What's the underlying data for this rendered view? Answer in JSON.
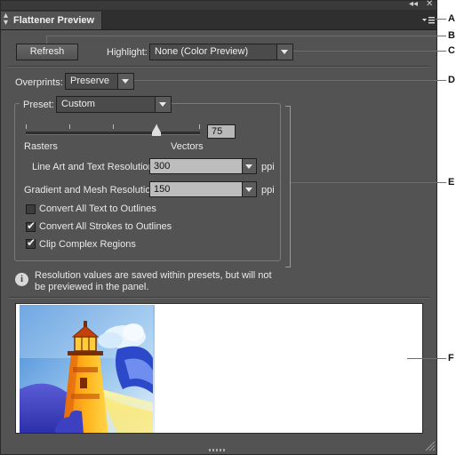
{
  "window": {
    "collapse_control": "◂◂",
    "close_control": "✕"
  },
  "panel": {
    "title": "Flattener Preview",
    "menu_icon": "panel-menu-icon"
  },
  "toolbar": {
    "refresh_label": "Refresh",
    "highlight_label": "Highlight:",
    "highlight_value": "None (Color Preview)"
  },
  "overprints": {
    "label": "Overprints:",
    "value": "Preserve"
  },
  "preset": {
    "label": "Preset:",
    "value": "Custom",
    "slider_value": "75",
    "slider_level_percent": 75,
    "rasters_label": "Rasters",
    "vectors_label": "Vectors",
    "line_art_label": "Line Art and Text Resolution:",
    "line_art_value": "300",
    "line_art_unit": "ppi",
    "gradient_label": "Gradient and Mesh Resolution:",
    "gradient_value": "150",
    "gradient_unit": "ppi",
    "checkboxes": [
      {
        "label": "Convert All Text to Outlines",
        "checked": false
      },
      {
        "label": "Convert All Strokes to Outlines",
        "checked": true
      },
      {
        "label": "Clip Complex Regions",
        "checked": true
      }
    ]
  },
  "info": {
    "icon": "info-icon",
    "line1": "Resolution values are saved within presets, but will not",
    "line2": "be previewed in the panel."
  },
  "preview": {
    "image": "lighthouse-artwork"
  },
  "callouts": [
    "A",
    "B",
    "C",
    "D",
    "E",
    "F"
  ],
  "colors": {
    "panel_bg": "#535353",
    "tab_bar_bg": "#2f2f2f",
    "field_bg": "#bdbdbd"
  }
}
